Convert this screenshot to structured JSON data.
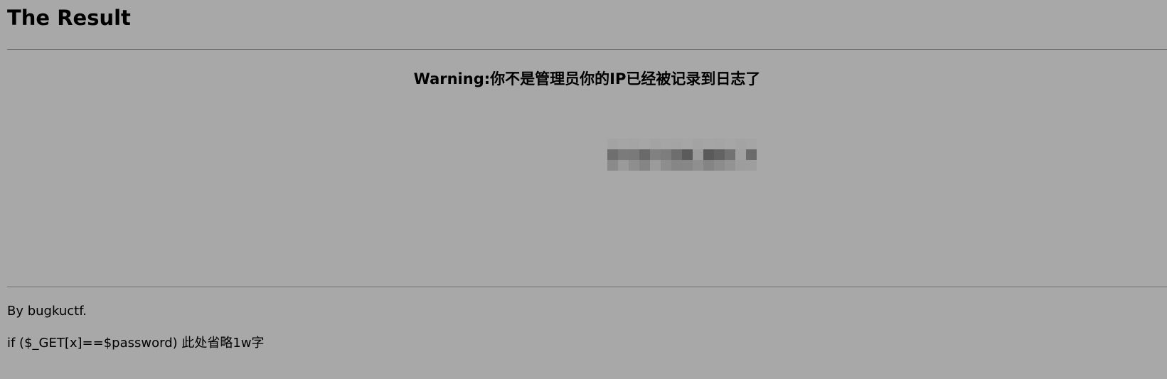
{
  "header": {
    "title": "The Result"
  },
  "main": {
    "warning": "Warning:你不是管理员你的IP已经被记录到日志了",
    "ip_address": "pixelated-ip-address"
  },
  "footer": {
    "byline": "By bugkuctf.",
    "code_hint": "if ($_GET[x]==$password) 此处省略1w字"
  },
  "colors": {
    "background": "#a8a8a8",
    "divider": "#6e6e6e",
    "text": "#000000"
  }
}
